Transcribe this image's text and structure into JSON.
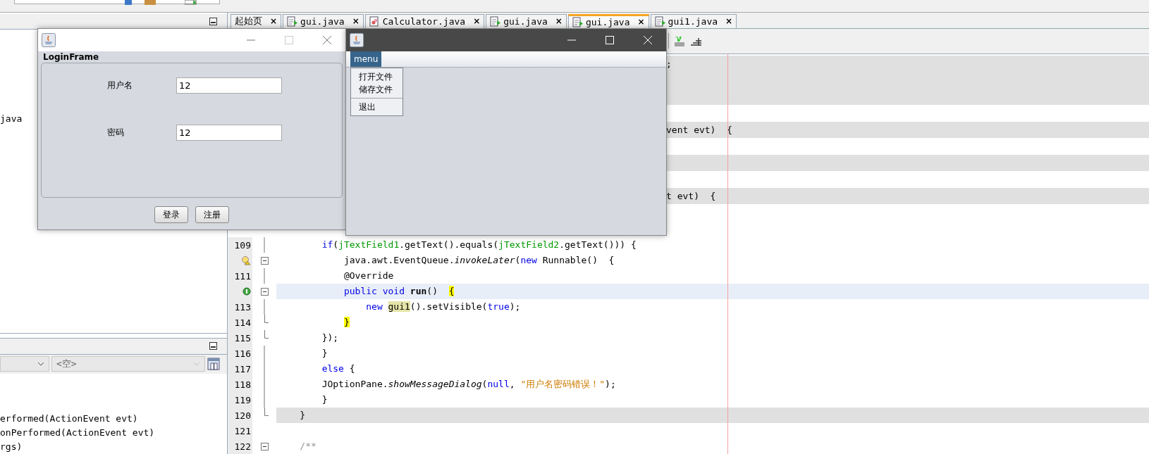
{
  "ide": {
    "project_panel": {
      "tree_text": "java"
    },
    "navigator": {
      "filter_combo": "<空>",
      "members": [
        {
          "text": "erformed(ActionEvent evt)"
        },
        {
          "text": "onPerformed(ActionEvent evt)"
        },
        {
          "text": "rgs)"
        }
      ]
    },
    "tabs": [
      {
        "label": "起始页",
        "close": "×",
        "kind": "start",
        "selected": false
      },
      {
        "label": "gui.java",
        "close": "×",
        "kind": "source",
        "selected": false
      },
      {
        "label": "Calculator.java",
        "close": "×",
        "kind": "form",
        "selected": false
      },
      {
        "label": "gui.java",
        "close": "×",
        "kind": "source",
        "selected": false
      },
      {
        "label": "gui.java",
        "close": "×",
        "kind": "source",
        "selected": true
      },
      {
        "label": "gui1.java",
        "close": "×",
        "kind": "source",
        "selected": false
      }
    ],
    "editor": {
      "covered_rows": [
        {
          "text": ";",
          "shaded": true
        },
        {
          "shaded": true
        },
        {
          "shaded": true
        },
        {
          "shaded": false
        },
        {
          "text": "vent evt)  {",
          "shaded": true
        },
        {
          "shaded": false
        },
        {
          "shaded": true
        },
        {
          "shaded": false
        },
        {
          "text": "t evt)  {",
          "shaded": true
        },
        {
          "shaded": false
        },
        {
          "shaded": false
        }
      ],
      "lines": [
        {
          "number": "109",
          "kind": "plain",
          "in_fold": true,
          "shaded": false,
          "current": false,
          "tokens": [
            {
              "t": "        if",
              "kind": "kw"
            },
            {
              "t": "(",
              "kind": "plain"
            },
            {
              "t": "jTextField1",
              "kind": "field"
            },
            {
              "t": ".getText().equals(",
              "kind": "plain"
            },
            {
              "t": "jTextField2",
              "kind": "field"
            },
            {
              "t": ".getText())) {",
              "kind": "plain"
            }
          ]
        },
        {
          "kind": "warning",
          "fold_start": true,
          "shaded": false,
          "current": false,
          "tokens": [
            {
              "t": "            java.awt.EventQueue.",
              "kind": "plain"
            },
            {
              "t": "invokeLater",
              "kind": "italic"
            },
            {
              "t": "(",
              "kind": "plain"
            },
            {
              "t": "new",
              "kind": "kw"
            },
            {
              "t": " Runnable()  {",
              "kind": "plain"
            }
          ]
        },
        {
          "number": "111",
          "kind": "plain",
          "in_fold": true,
          "shaded": false,
          "current": false,
          "tokens": [
            {
              "t": "            @Override",
              "kind": "plain"
            }
          ]
        },
        {
          "kind": "implements",
          "fold_start": true,
          "shaded": false,
          "current": true,
          "tokens": [
            {
              "t": "            public void",
              "kind": "kw"
            },
            {
              "t": " run",
              "kind": "bold"
            },
            {
              "t": "()",
              "kind": "plain"
            },
            {
              "t": "  {",
              "kind": "hl"
            }
          ]
        },
        {
          "number": "113",
          "kind": "plain",
          "in_fold": true,
          "shaded": false,
          "current": false,
          "tokens": [
            {
              "t": "                new",
              "kind": "kw"
            },
            {
              "t": " gui1",
              "kind": "mark"
            },
            {
              "t": "().setVisible(",
              "kind": "plain"
            },
            {
              "t": "true",
              "kind": "kw"
            },
            {
              "t": ");",
              "kind": "plain"
            }
          ]
        },
        {
          "number": "114",
          "kind": "plain",
          "fold_end": true,
          "shaded": false,
          "current": false,
          "tokens": [
            {
              "t": "            }",
              "kind": "hl"
            }
          ]
        },
        {
          "number": "115",
          "kind": "plain",
          "fold_end": true,
          "shaded": false,
          "current": false,
          "tokens": [
            {
              "t": "        });",
              "kind": "plain"
            }
          ]
        },
        {
          "number": "116",
          "kind": "plain",
          "in_fold": true,
          "shaded": false,
          "current": false,
          "tokens": [
            {
              "t": "        }",
              "kind": "plain"
            }
          ]
        },
        {
          "number": "117",
          "kind": "plain",
          "in_fold": true,
          "shaded": false,
          "current": false,
          "tokens": [
            {
              "t": "        else",
              "kind": "kw"
            },
            {
              "t": " {",
              "kind": "plain"
            }
          ]
        },
        {
          "number": "118",
          "kind": "plain",
          "in_fold": true,
          "shaded": false,
          "current": false,
          "tokens": [
            {
              "t": "        JOptionPane.",
              "kind": "plain"
            },
            {
              "t": "showMessageDialog",
              "kind": "italic"
            },
            {
              "t": "(",
              "kind": "plain"
            },
            {
              "t": "null",
              "kind": "kw"
            },
            {
              "t": ", ",
              "kind": "plain"
            },
            {
              "t": "\"用户名密码错误！\"",
              "kind": "str"
            },
            {
              "t": ");",
              "kind": "plain"
            }
          ]
        },
        {
          "number": "119",
          "kind": "plain",
          "in_fold": true,
          "shaded": false,
          "current": false,
          "tokens": [
            {
              "t": "        }",
              "kind": "plain"
            }
          ]
        },
        {
          "number": "120",
          "kind": "plain",
          "fold_end": true,
          "shaded": true,
          "current": false,
          "tokens": [
            {
              "t": "    }",
              "kind": "plain"
            }
          ]
        },
        {
          "number": "121",
          "kind": "plain"
        },
        {
          "number": "122",
          "kind": "plain",
          "fold_start": true,
          "shaded": false,
          "current": false,
          "tokens": [
            {
              "t": "    /**",
              "kind": "comment"
            }
          ]
        }
      ]
    }
  },
  "login_window": {
    "group_title": "LoginFrame",
    "fields": [
      {
        "label": "用户名",
        "value": "12"
      },
      {
        "label": "密码",
        "value": "12"
      }
    ],
    "buttons": [
      "登录",
      "注册"
    ]
  },
  "menu_window": {
    "menu": {
      "label": "menu",
      "selected": true
    },
    "popup": [
      {
        "label": "打开文件",
        "separator_before": false
      },
      {
        "label": "储存文件",
        "separator_before": false
      },
      {
        "label": "退出",
        "separator_before": true
      }
    ]
  }
}
